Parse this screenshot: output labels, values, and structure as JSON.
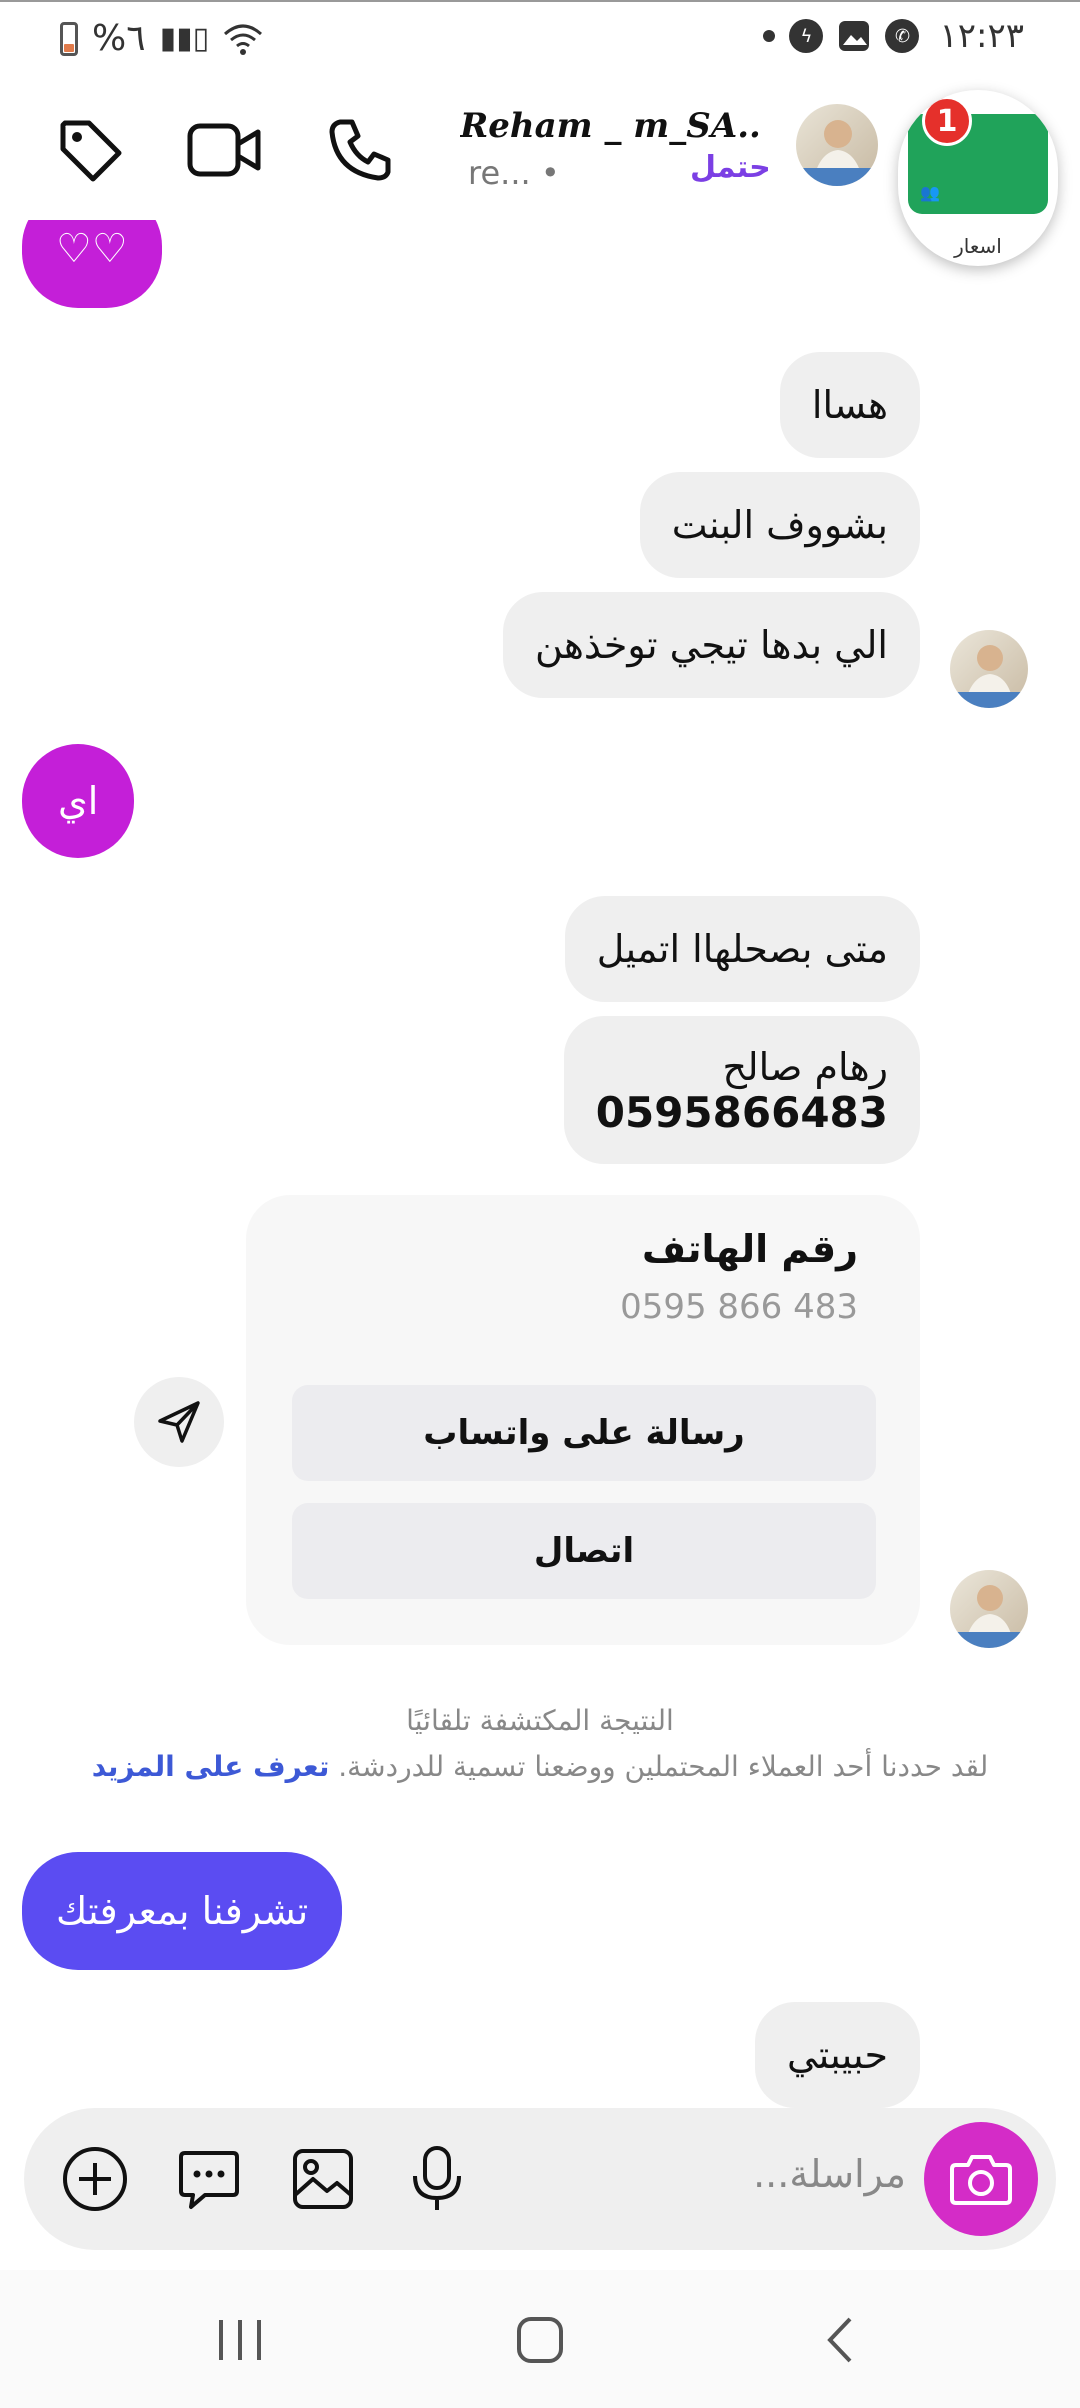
{
  "status_bar": {
    "time": "١٢:٢٣",
    "battery": "%٦"
  },
  "header": {
    "contact_name": "Reham _ m_SA...",
    "username": "re... •",
    "label": "حتمل",
    "bubble_badge": "1",
    "bubble_label": "اسعار"
  },
  "messages": {
    "partial_heart": "♡♡",
    "m1": "هساا",
    "m2": "بشووف البنت",
    "m3": "الي بدها تيجي توخذهن",
    "m4": "اي",
    "m5": "متى بصحلهاا اتميل",
    "m6_name": "رهام صالح",
    "m6_number": "0595866483",
    "m7": "تشرفنا بمعرفتك",
    "m8": "حبيبتي"
  },
  "contact_card": {
    "title": "رقم الهاتف",
    "number": "0595 866 483",
    "whatsapp_button": "رسالة على واتساب",
    "call_button": "اتصال"
  },
  "notice": {
    "title": "النتيجة المكتشفة تلقائيًا",
    "body": "لقد حددنا أحد العملاء المحتملين ووضعنا تسمية للدردشة.",
    "link": "تعرف على المزيد"
  },
  "composer": {
    "placeholder": "مراسلة..."
  },
  "colors": {
    "outgoing_purple": "#c41fd8",
    "outgoing_blue": "#5b4cf2",
    "camera_magenta": "#d42cc7",
    "link_blue": "#3d59d6"
  }
}
